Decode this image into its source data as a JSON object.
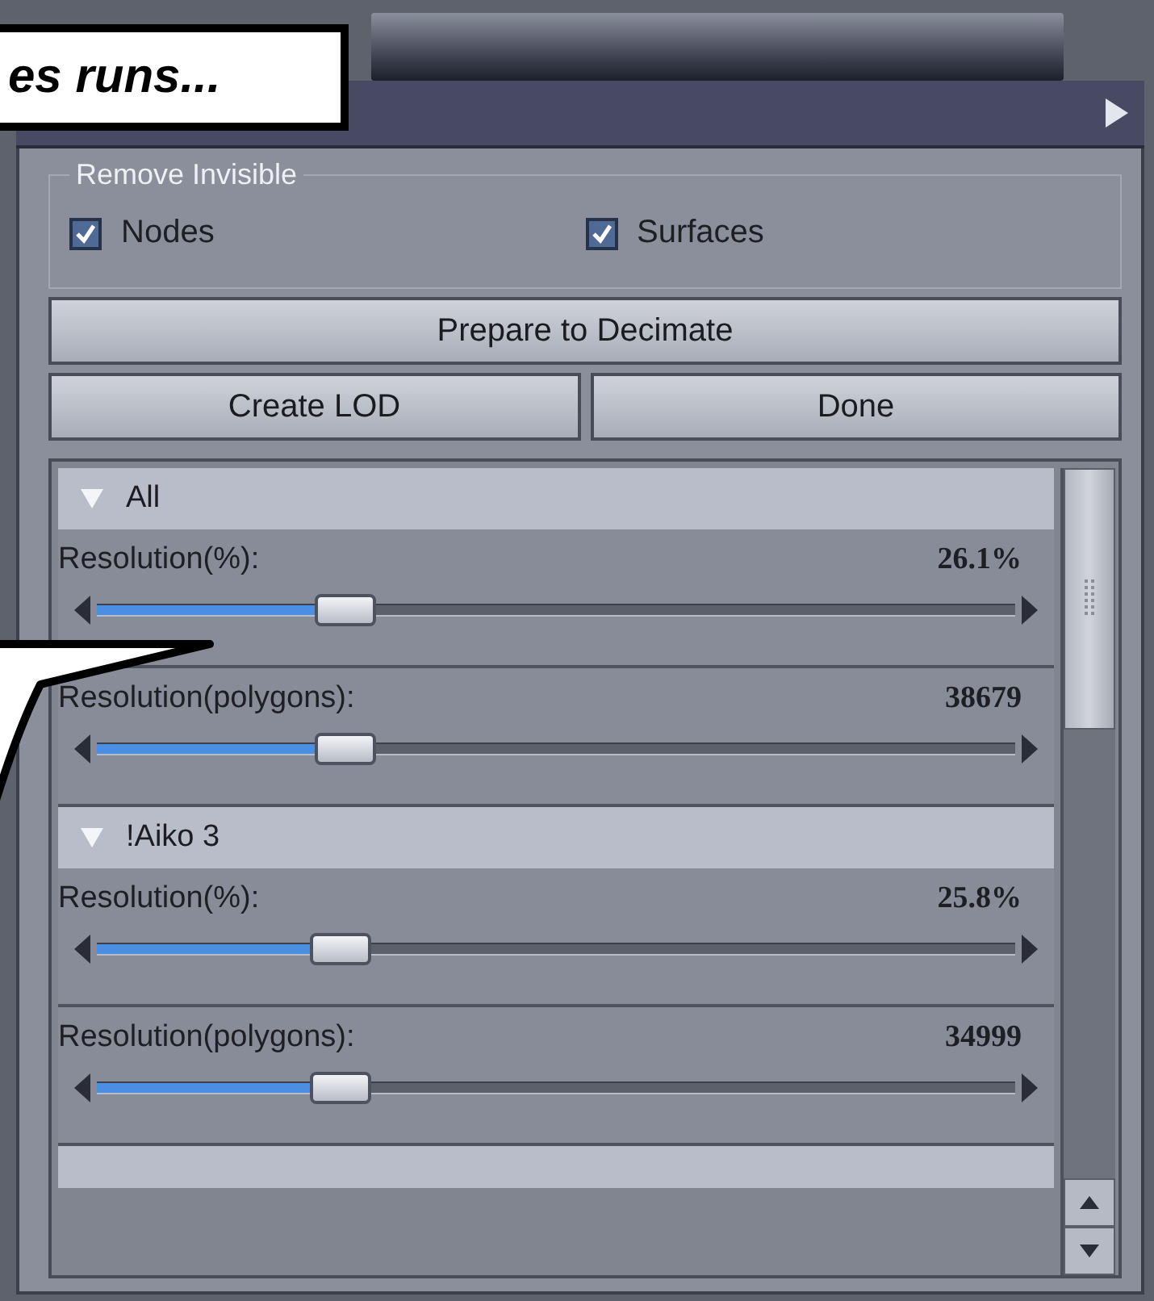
{
  "callout": {
    "text": "es runs..."
  },
  "remove_invisible": {
    "title": "Remove Invisible",
    "checkboxes": [
      {
        "label": "Nodes",
        "checked": true
      },
      {
        "label": "Surfaces",
        "checked": true
      }
    ]
  },
  "prepare_button": {
    "label": "Prepare to Decimate"
  },
  "action_buttons": [
    {
      "label": "Create LOD"
    },
    {
      "label": "Done"
    }
  ],
  "figures": [
    {
      "name": "All",
      "expanded": true,
      "sliders": [
        {
          "label": "Resolution(%):",
          "value": "26.1%",
          "level": 0.27
        },
        {
          "label": "Resolution(polygons):",
          "value": "38679",
          "level": 0.27
        }
      ]
    },
    {
      "name": "!Aiko 3",
      "expanded": true,
      "sliders": [
        {
          "label": "Resolution(%):",
          "value": "25.8%",
          "level": 0.265
        },
        {
          "label": "Resolution(polygons):",
          "value": "34999",
          "level": 0.265
        }
      ]
    }
  ]
}
